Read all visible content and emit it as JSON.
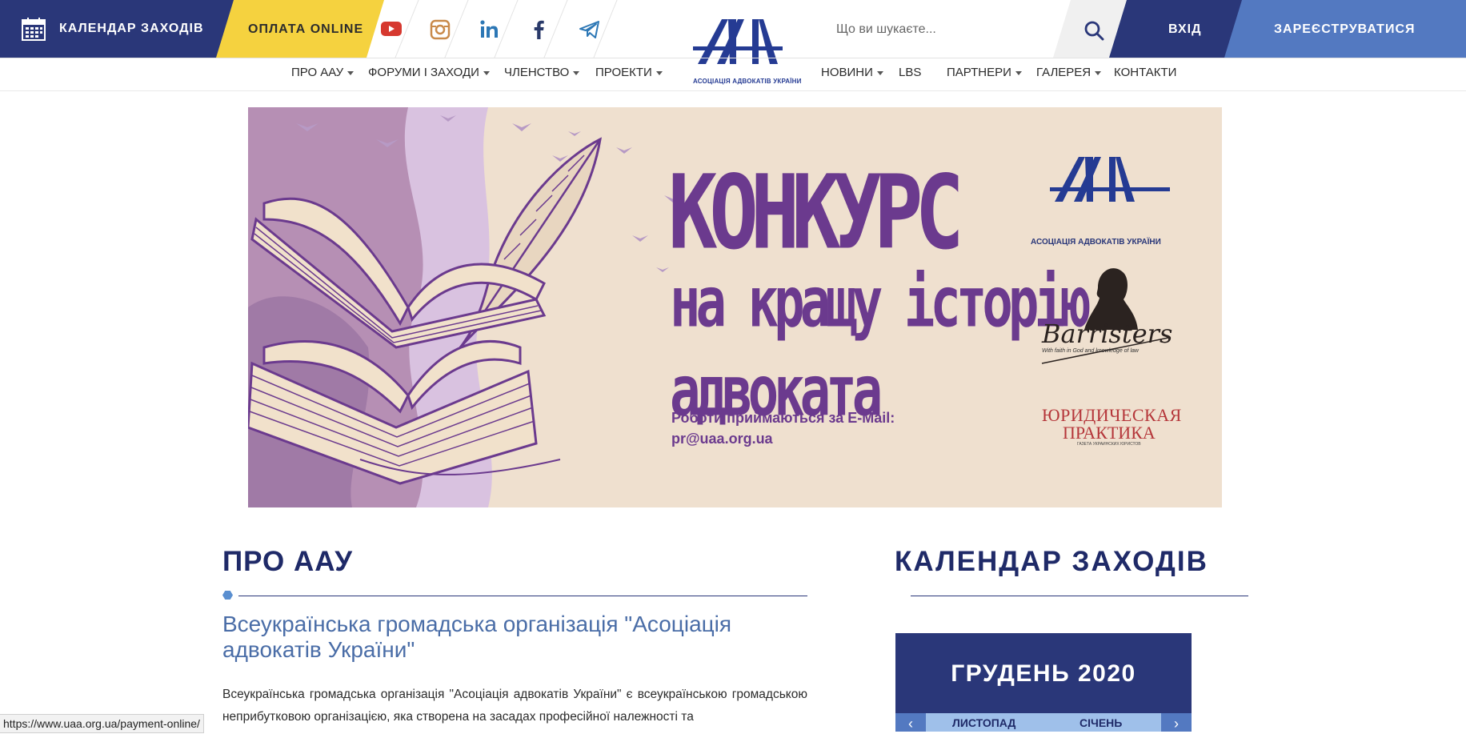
{
  "topbar": {
    "calendar_label": "КАЛЕНДАР ЗАХОДІВ",
    "payment_label": "ОПЛАТА ONLINE",
    "search_placeholder": "Що ви шукаєте...",
    "login_label": "ВХІД",
    "register_label": "ЗАРЕЄСТРУВАТИСЯ",
    "social_icons": [
      "youtube-icon",
      "instagram-icon",
      "linkedin-icon",
      "facebook-icon",
      "telegram-icon"
    ],
    "logo_caption": "АСОЦІАЦІЯ АДВОКАТІВ УКРАЇНИ"
  },
  "nav": {
    "left": [
      {
        "label": "ПРО ААУ",
        "dropdown": true
      },
      {
        "label": "ФОРУМИ І ЗАХОДИ",
        "dropdown": true
      },
      {
        "label": "ЧЛЕНСТВО",
        "dropdown": true
      },
      {
        "label": "ПРОЕКТИ",
        "dropdown": true
      }
    ],
    "right": [
      {
        "label": "НОВИНИ",
        "dropdown": true
      },
      {
        "label": "LBS",
        "dropdown": false
      },
      {
        "label": "ПАРТНЕРИ",
        "dropdown": true
      },
      {
        "label": "ГАЛЕРЕЯ",
        "dropdown": true
      },
      {
        "label": "КОНТАКТИ",
        "dropdown": false
      }
    ]
  },
  "banner": {
    "title_line1": "КОНКУРС",
    "title_line2": "на кращу історію",
    "title_line3": "адвоката",
    "email_label": "Роботи приймаються за E-Mail:",
    "email": "pr@uaa.org.ua",
    "logo1_caption": "АСОЦІАЦІЯ АДВОКАТІВ УКРАЇНИ",
    "logo2_word": "Barristers",
    "logo2_caption": "With faith in God and knowledge of law",
    "logo3_line1": "ЮРИДИЧЕСКАЯ",
    "logo3_line2": "ПРАКТИКА",
    "logo3_caption": "ГАЗЕТА УКРАИНСКИХ ЮРИСТОВ",
    "slides_total": 2,
    "slide_active": 2,
    "colors": {
      "accent": "#6b3a8e",
      "background": "#efe0cf",
      "lilac": "#c9a9d6"
    }
  },
  "about": {
    "heading": "ПРО ААУ",
    "subtitle": "Всеукраїнська громадська організація \"Асоціація адвокатів України\"",
    "paragraph": "Всеукраїнська громадська організація \"Асоціація адвокатів України\" є всеукраїнською громадською неприбутковою організацією, яка створена на засадах професійної належності та"
  },
  "calendar": {
    "heading": "КАЛЕНДАР ЗАХОДІВ",
    "month_title": "ГРУДЕНЬ 2020",
    "prev_label": "ЛИСТОПАД",
    "next_label": "СІЧЕНЬ"
  },
  "status_url": "https://www.uaa.org.ua/payment-online/",
  "colors": {
    "primary": "#2a3779",
    "secondary": "#5379c1",
    "yellow": "#f5d23f",
    "heading": "#1f2a68"
  }
}
